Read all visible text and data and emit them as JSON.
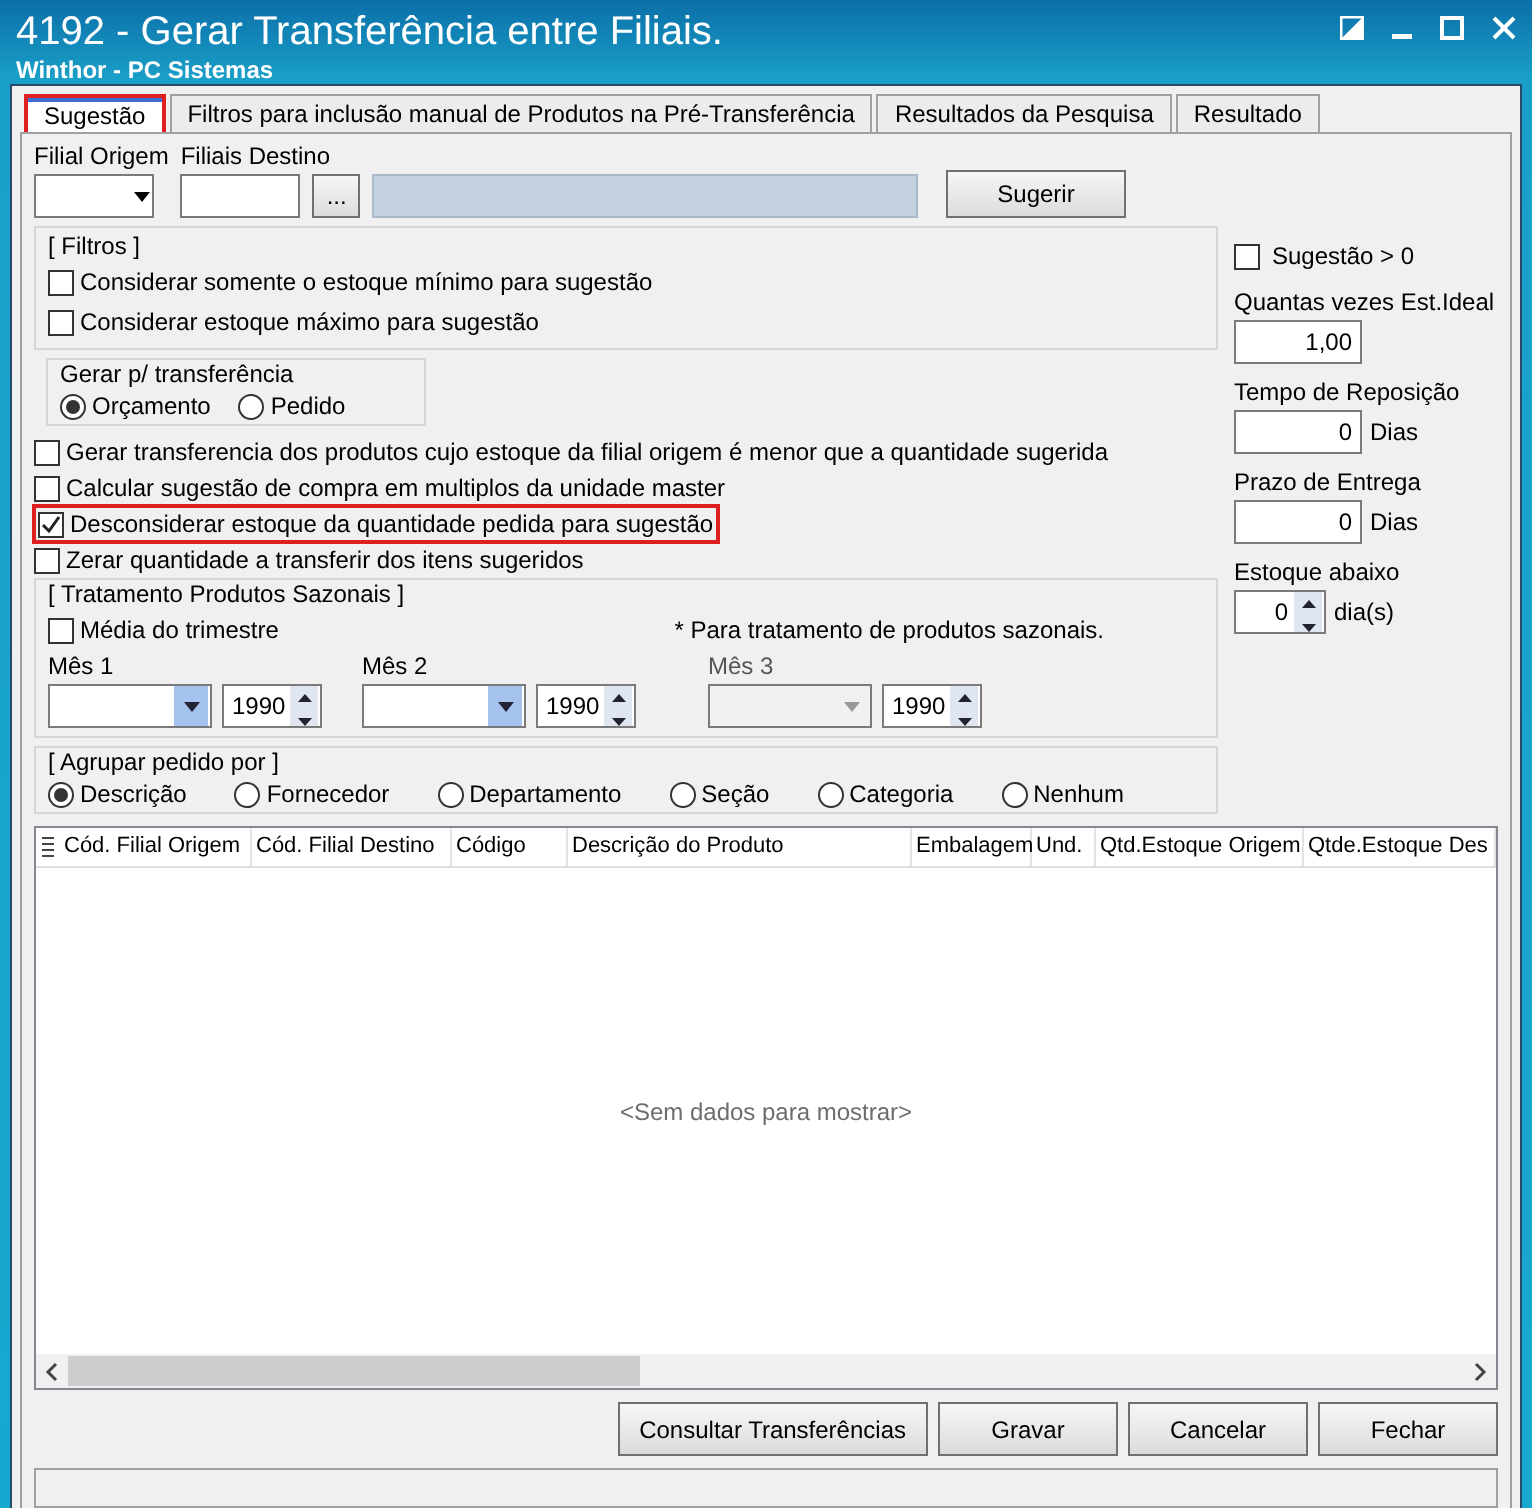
{
  "window": {
    "title": "4192 - Gerar Transferência entre Filiais.",
    "subtitle": "Winthor - PC Sistemas"
  },
  "tabs": [
    {
      "label": "Sugestão",
      "selected": true,
      "highlighted": true
    },
    {
      "label": "Filtros para inclusão manual de Produtos na Pré-Transferência",
      "selected": false,
      "highlighted": false
    },
    {
      "label": "Resultados da Pesquisa",
      "selected": false,
      "highlighted": false
    },
    {
      "label": "Resultado",
      "selected": false,
      "highlighted": false
    }
  ],
  "filial_origem": {
    "label": "Filial Origem"
  },
  "filiais_destino": {
    "label": "Filiais Destino",
    "browse": "..."
  },
  "sugerir_button": "Sugerir",
  "filtros": {
    "title": "[ Filtros ]",
    "options": [
      {
        "label": "Considerar somente o estoque mínimo para sugestão",
        "checked": false
      },
      {
        "label": "Considerar estoque máximo para sugestão",
        "checked": false
      }
    ]
  },
  "gerar": {
    "title": "Gerar p/ transferência",
    "options": [
      {
        "label": "Orçamento",
        "selected": true
      },
      {
        "label": "Pedido",
        "selected": false
      }
    ]
  },
  "options": [
    {
      "label": "Gerar transferencia dos produtos cujo estoque da filial origem é menor que a quantidade sugerida",
      "checked": false,
      "highlighted": false
    },
    {
      "label": "Calcular sugestão de compra em multiplos da unidade master",
      "checked": false,
      "highlighted": false
    },
    {
      "label": "Desconsiderar estoque da quantidade pedida para sugestão",
      "checked": true,
      "highlighted": true
    },
    {
      "label": "Zerar quantidade a transferir dos itens sugeridos",
      "checked": false,
      "highlighted": false
    }
  ],
  "sazonais": {
    "title": "[ Tratamento Produtos Sazonais ]",
    "media": {
      "label": "Média do trimestre",
      "checked": false
    },
    "note": "* Para tratamento de produtos sazonais.",
    "months": [
      {
        "label": "Mês 1",
        "year": "1990",
        "disabled": false
      },
      {
        "label": "Mês 2",
        "year": "1990",
        "disabled": false
      },
      {
        "label": "Mês 3",
        "year": "1990",
        "disabled": true
      }
    ]
  },
  "agrupar": {
    "title": "[ Agrupar pedido por ]",
    "options": [
      {
        "label": "Descrição",
        "selected": true
      },
      {
        "label": "Fornecedor",
        "selected": false
      },
      {
        "label": "Departamento",
        "selected": false
      },
      {
        "label": "Seção",
        "selected": false
      },
      {
        "label": "Categoria",
        "selected": false
      },
      {
        "label": "Nenhum",
        "selected": false
      }
    ]
  },
  "right": {
    "sugestao_maior": {
      "label": "Sugestão > 0",
      "checked": false
    },
    "fields": [
      {
        "label": "Quantas vezes Est.Ideal",
        "value": "1,00",
        "kind": "plain"
      },
      {
        "label": "Tempo de Reposição",
        "value": "0",
        "unit": "Dias",
        "kind": "unit"
      },
      {
        "label": "Prazo de Entrega",
        "value": "0",
        "unit": "Dias",
        "kind": "unit"
      },
      {
        "label": "Estoque abaixo",
        "value": "0",
        "unit": "dia(s)",
        "kind": "spin"
      }
    ]
  },
  "table": {
    "columns": [
      "Cód. Filial Origem",
      "Cód. Filial Destino",
      "Código",
      "Descrição do Produto",
      "Embalagem",
      "Und.",
      "Qtd.Estoque Origem",
      "Qtde.Estoque Des"
    ],
    "empty": "<Sem dados para mostrar>"
  },
  "buttons": [
    "Consultar Transferências",
    "Gravar",
    "Cancelar",
    "Fechar"
  ]
}
